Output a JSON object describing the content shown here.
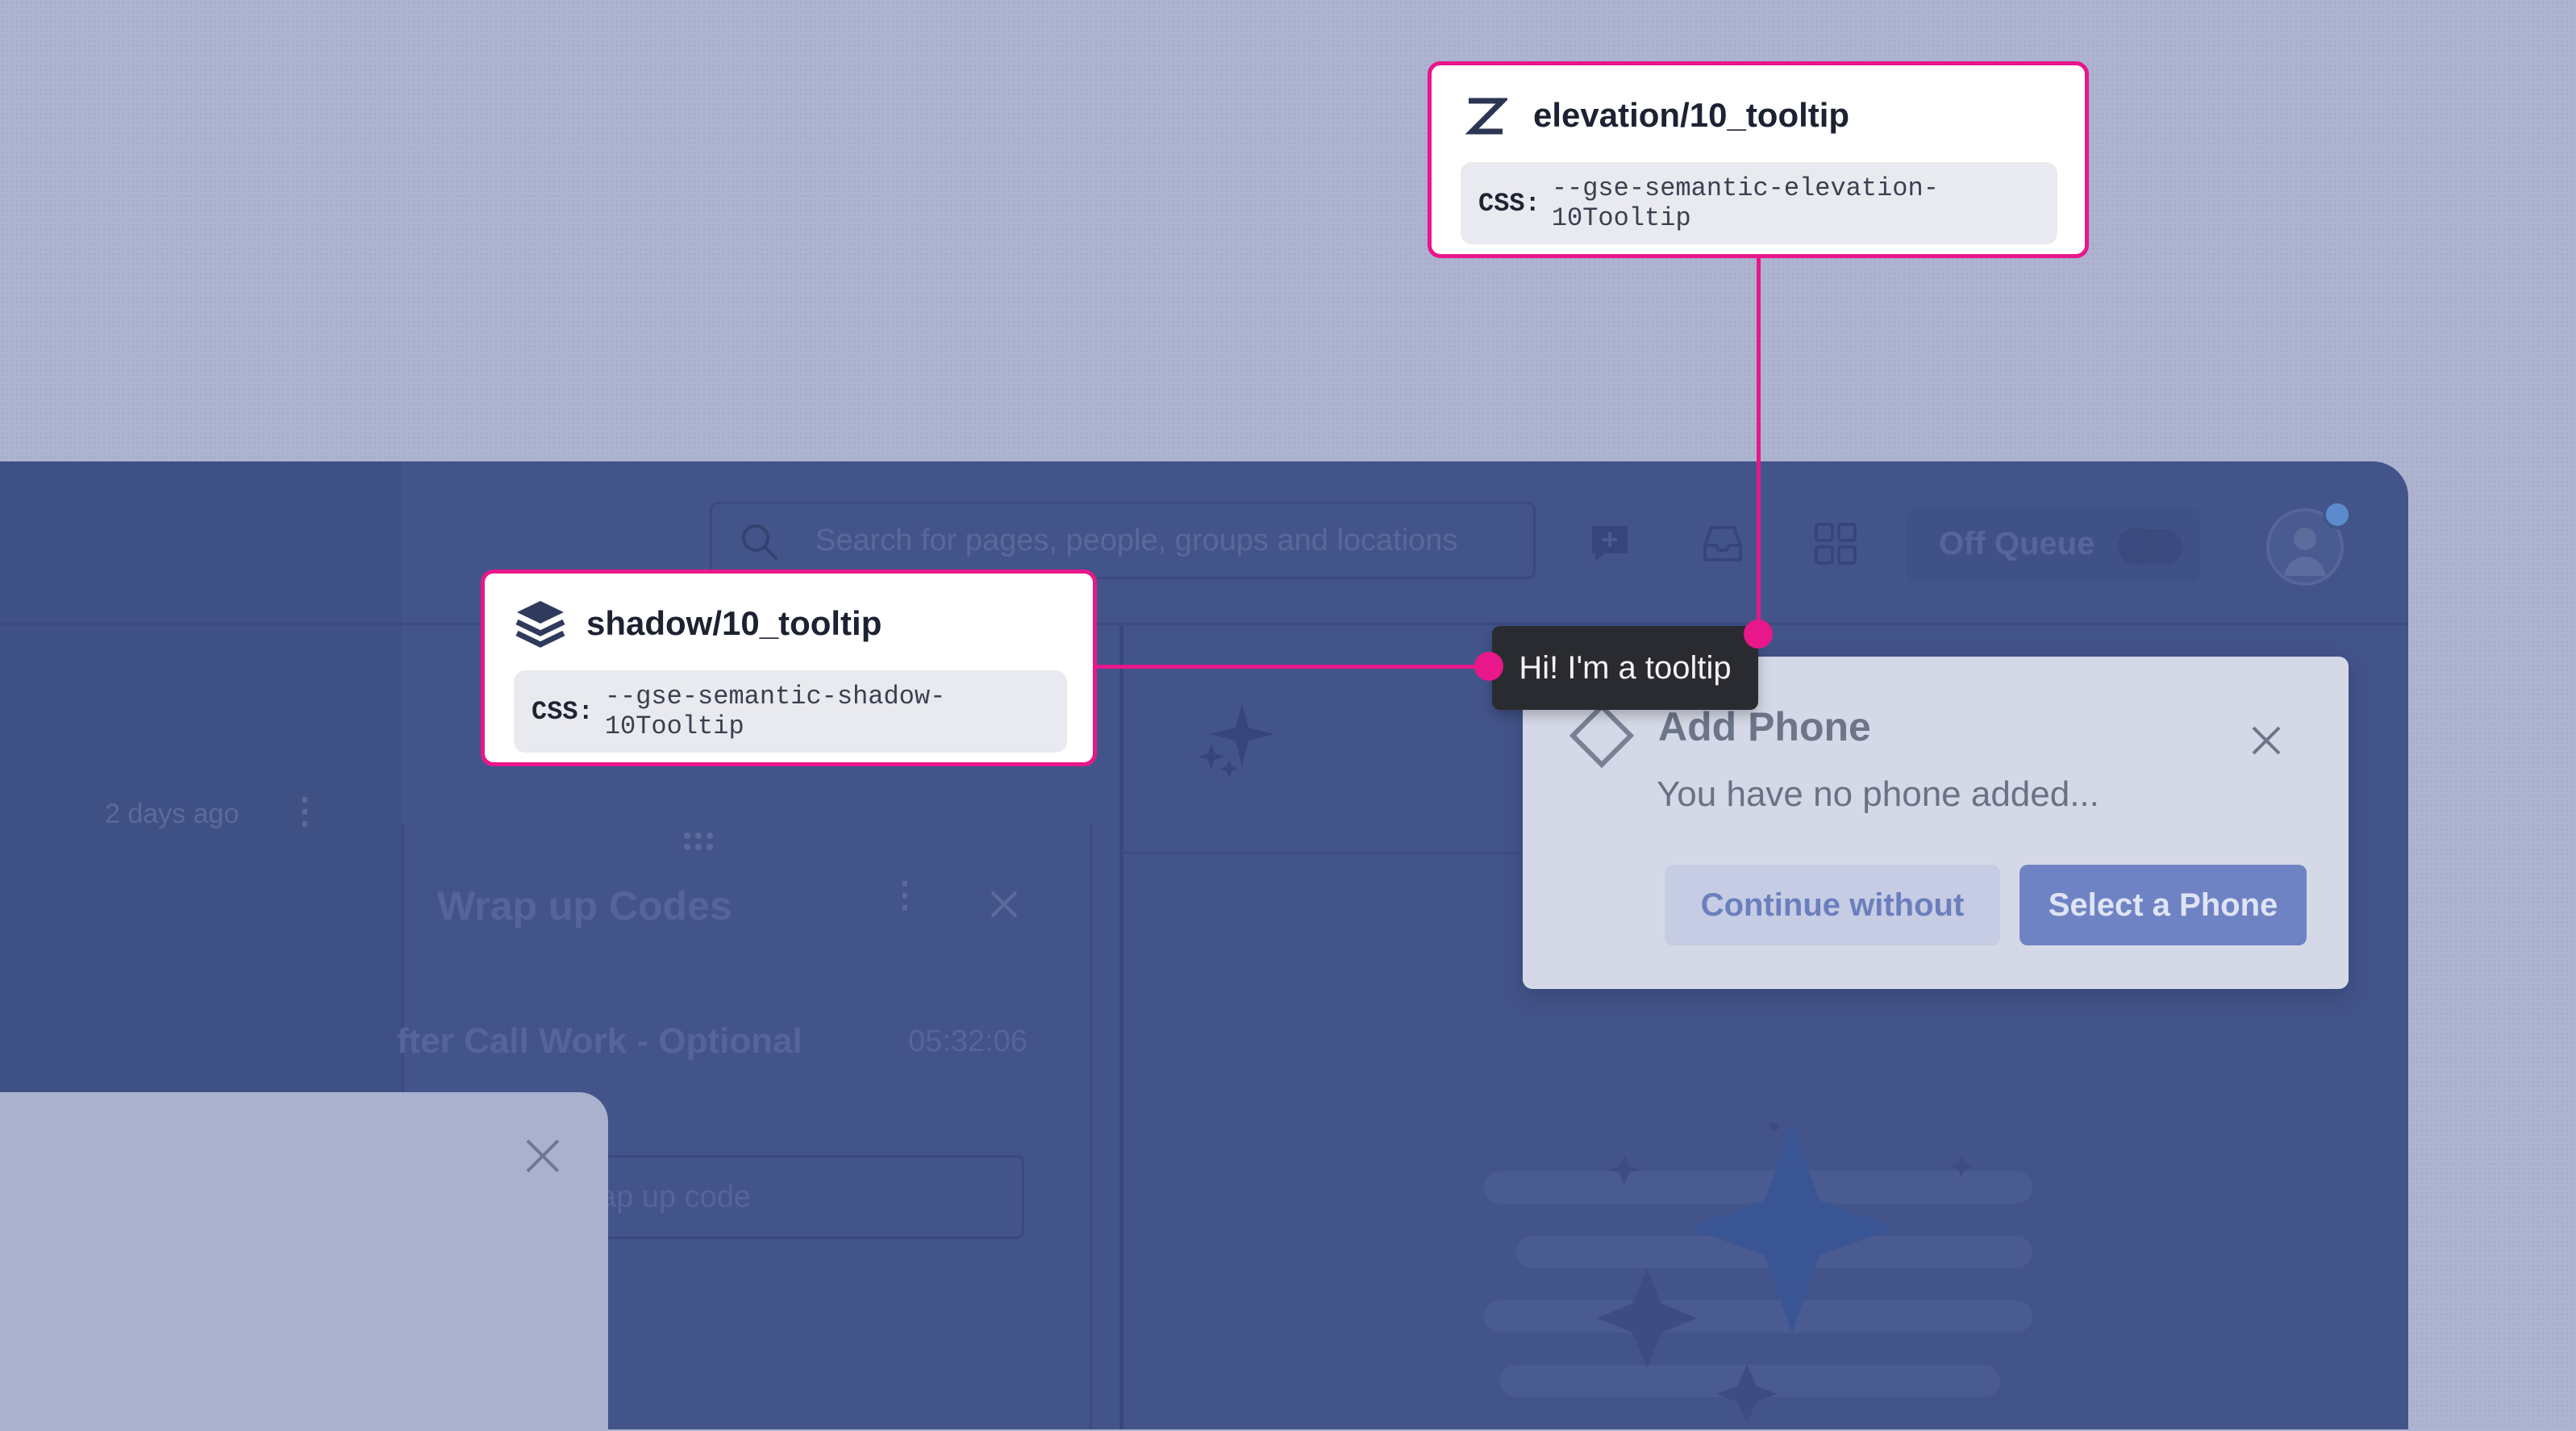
{
  "topbar": {
    "search_placeholder": "Search for pages, people, groups and locations",
    "queue_label": "Off Queue"
  },
  "list": {
    "timestamp": "2 days ago"
  },
  "wrapup": {
    "title": "Wrap up  Codes",
    "item_label": "fter Call Work - Optional",
    "item_time": "05:32:06",
    "input_placeholder": "ap up code"
  },
  "dialog": {
    "title": "Add Phone",
    "message": "You have no phone added...",
    "continue_label": "Continue without",
    "select_label": "Select a Phone"
  },
  "tooltip": {
    "text": "Hi! I'm a tooltip"
  },
  "annotations": {
    "elevation": {
      "icon": "z-axis-icon",
      "title": "elevation/10_tooltip",
      "css_label": "CSS:",
      "css_value": "--gse-semantic-elevation-10Tooltip"
    },
    "shadow": {
      "icon": "layers-icon",
      "title": "shadow/10_tooltip",
      "css_label": "CSS:",
      "css_value": "--gse-semantic-shadow-10Tooltip"
    }
  },
  "colors": {
    "annotation_accent": "#e8178a",
    "app_background": "#43548a",
    "tooltip_background": "#2a2b30",
    "primary_button": "#6f83c4"
  }
}
